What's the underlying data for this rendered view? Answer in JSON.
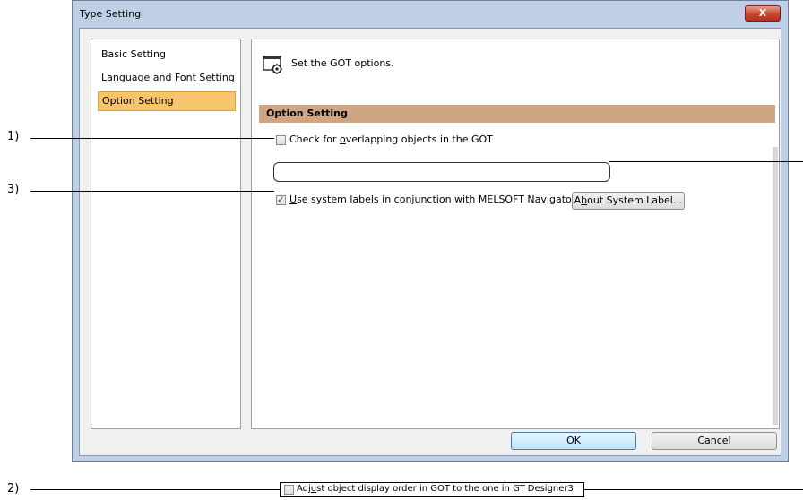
{
  "window": {
    "title": "Type Setting",
    "close_label": "X"
  },
  "nav": {
    "items": [
      {
        "label": "Basic Setting"
      },
      {
        "label": "Language and Font Setting"
      },
      {
        "label": "Option Setting",
        "selected": true
      }
    ]
  },
  "panel": {
    "header_icon": "settings-gear-window-icon",
    "header_text": "Set the GOT options.",
    "section_title": "Option Setting",
    "options": {
      "overlap": {
        "label_pre": "Check for ",
        "label_acc": "o",
        "label_post": "verlapping objects in the GOT",
        "checked": false
      },
      "system_labels": {
        "label_pre": "",
        "label_acc": "U",
        "label_post": "se system labels in conjunction with MELSOFT Navigator",
        "checked": true
      },
      "about_button": {
        "pre": "A",
        "acc": "b",
        "post": "out System Label..."
      }
    }
  },
  "footer": {
    "ok_label": "OK",
    "cancel_label": "Cancel"
  },
  "callouts": {
    "c1": "1)",
    "c2": "2)",
    "c3": "3)",
    "adjust_option": {
      "pre": "Adj",
      "acc": "u",
      "post": "st object display order in GOT to the one in GT Designer3",
      "checked": false
    }
  },
  "colors": {
    "section_bar": "#d0a583",
    "selected_nav": "#f6c56b",
    "window_frame": "#bfd0e6"
  }
}
